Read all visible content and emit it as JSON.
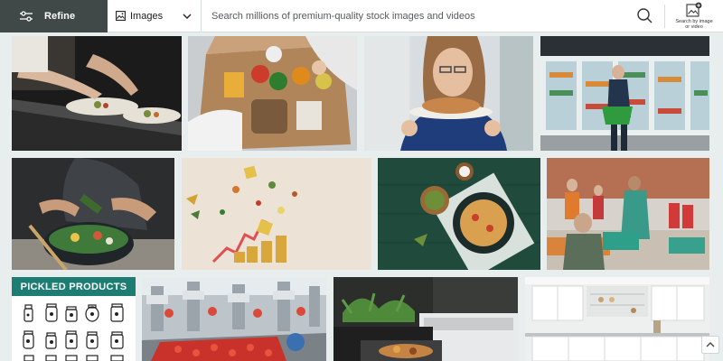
{
  "toolbar": {
    "refine_label": "Refine",
    "media_type": "Images",
    "search_placeholder": "Search millions of premium-quality stock images and videos",
    "search_value": "",
    "visual_search_label": "Search by image or video"
  },
  "images": [
    {
      "id": "chefs-plating",
      "alt": "Chefs plating dishes in restaurant kitchen"
    },
    {
      "id": "grocery-box",
      "alt": "Hands unpacking a box of groceries"
    },
    {
      "id": "woman-bread",
      "alt": "Woman enjoying a plate of bread"
    },
    {
      "id": "supermarket-freezer",
      "alt": "Shopper at supermarket freezer aisle"
    },
    {
      "id": "salad-bowl",
      "alt": "Hands tossing a salad bowl"
    },
    {
      "id": "coins-food-chart",
      "alt": "Food ingredients and coin stacks with rising arrow"
    },
    {
      "id": "pasta-table",
      "alt": "Pasta plate on green wooden table"
    },
    {
      "id": "food-bank",
      "alt": "Volunteers at a food bank"
    },
    {
      "id": "pickled-products",
      "alt": "Pickled products icon set"
    },
    {
      "id": "factory-line",
      "alt": "Food factory production line"
    },
    {
      "id": "oven-food",
      "alt": "Food in an oven"
    },
    {
      "id": "white-kitchen",
      "alt": "Bright white kitchen interior"
    }
  ],
  "pickled": {
    "banner": "PICKLED PRODUCTS"
  },
  "scroll_top_label": "Scroll to top"
}
